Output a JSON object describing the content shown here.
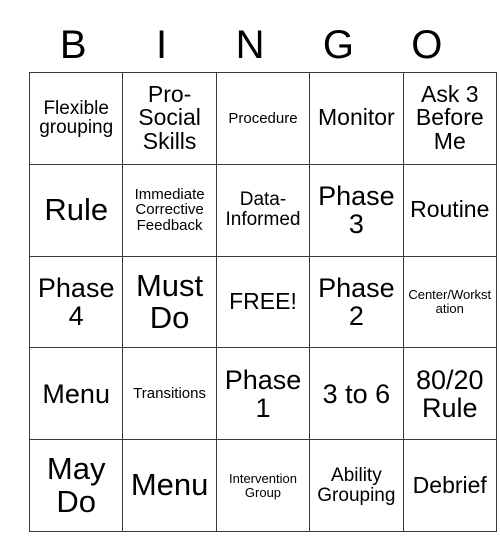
{
  "card": {
    "header_letters": [
      "B",
      "I",
      "N",
      "G",
      "O"
    ],
    "rows": [
      [
        {
          "text": "Flexible grouping",
          "size": "md"
        },
        {
          "text": "Pro-Social Skills",
          "size": "lg"
        },
        {
          "text": "Procedure",
          "size": "sm"
        },
        {
          "text": "Monitor",
          "size": "lg"
        },
        {
          "text": "Ask 3 Before Me",
          "size": "lg"
        }
      ],
      [
        {
          "text": "Rule",
          "size": "xxl"
        },
        {
          "text": "Immediate Corrective Feedback",
          "size": "sm"
        },
        {
          "text": "Data-Informed",
          "size": "md"
        },
        {
          "text": "Phase 3",
          "size": "xl"
        },
        {
          "text": "Routine",
          "size": "lg"
        }
      ],
      [
        {
          "text": "Phase 4",
          "size": "xl"
        },
        {
          "text": "Must Do",
          "size": "xxl"
        },
        {
          "text": "FREE!",
          "size": "lg"
        },
        {
          "text": "Phase 2",
          "size": "xl"
        },
        {
          "text": "Center/Workstation",
          "size": "xs"
        }
      ],
      [
        {
          "text": "Menu",
          "size": "xl"
        },
        {
          "text": "Transitions",
          "size": "sm"
        },
        {
          "text": "Phase 1",
          "size": "xl"
        },
        {
          "text": "3 to 6",
          "size": "xl"
        },
        {
          "text": "80/20 Rule",
          "size": "xl"
        }
      ],
      [
        {
          "text": "May Do",
          "size": "xxl"
        },
        {
          "text": "Menu",
          "size": "xxl"
        },
        {
          "text": "Intervention Group",
          "size": "xs"
        },
        {
          "text": "Ability Grouping",
          "size": "md"
        },
        {
          "text": "Debrief",
          "size": "lg"
        }
      ]
    ]
  },
  "colors": {
    "background": "#ffffff",
    "border": "#3a3a3a",
    "text": "#000000"
  }
}
